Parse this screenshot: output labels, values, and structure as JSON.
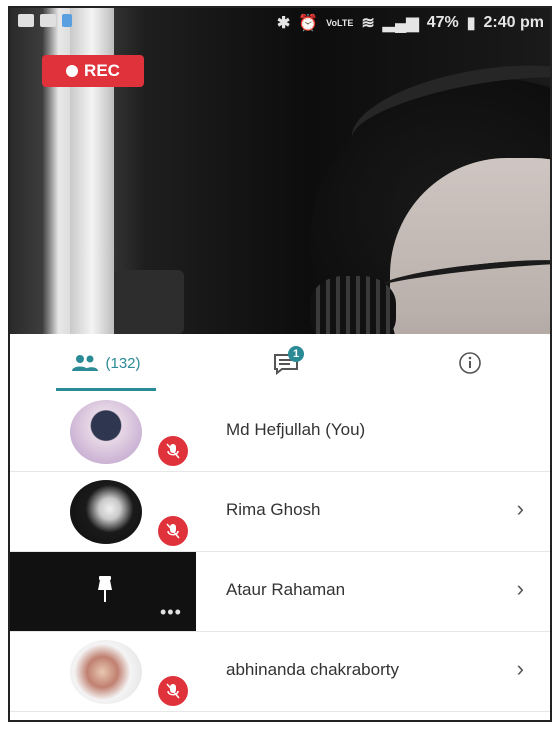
{
  "status_bar": {
    "carrier_label": "VoLTE",
    "battery": "47%",
    "time": "2:40 pm"
  },
  "recording": {
    "label": "REC"
  },
  "tabs": {
    "participants_count": "(132)",
    "chat_badge": "1"
  },
  "participants": [
    {
      "name": "Md Hefjullah (You)",
      "muted": true
    },
    {
      "name": "Rima Ghosh",
      "muted": true
    },
    {
      "name": "Ataur Rahaman",
      "muted": false
    },
    {
      "name": "abhinanda chakraborty",
      "muted": true
    }
  ],
  "icons": {
    "chevron": "›",
    "more": "•••"
  },
  "colors": {
    "accent": "#2a8a95",
    "rec": "#e0323a"
  }
}
